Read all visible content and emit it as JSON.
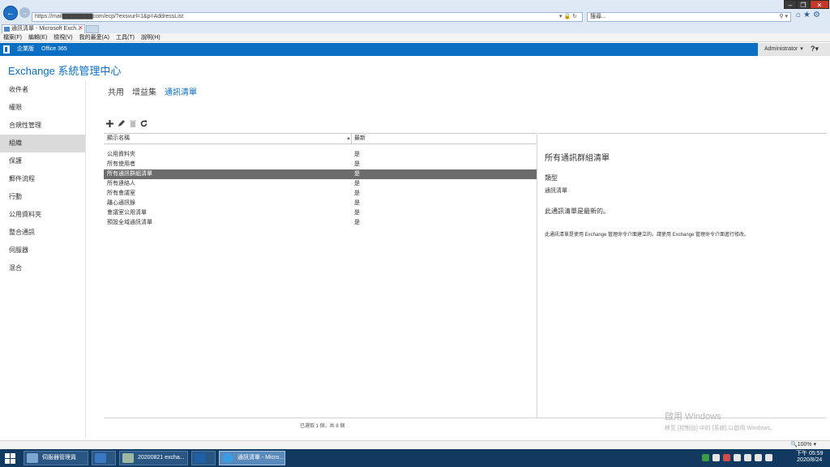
{
  "browser": {
    "address": "https://mail▇▇▇▇▇▇▇com/ecp/?exsvurl=1&p=AddressList",
    "search_placeholder": "搜尋...",
    "tab_title": "通訊清單 - Microsoft Exch...",
    "menu": [
      "檔案(F)",
      "編輯(E)",
      "檢視(V)",
      "我的最愛(A)",
      "工具(T)",
      "說明(H)"
    ],
    "zoom": "100%"
  },
  "o365": {
    "enterprise": "企業版",
    "office365": "Office 365",
    "user": "Administrator",
    "help": "?"
  },
  "eac": {
    "title": "Exchange 系統管理中心",
    "nav": [
      "收件者",
      "權限",
      "合規性管理",
      "組織",
      "保護",
      "郵件流程",
      "行動",
      "公用資料夾",
      "整合通訊",
      "伺服器",
      "混合"
    ],
    "active_nav": "組織",
    "subtabs": [
      "共用",
      "增益集",
      "通訊清單"
    ],
    "active_subtab": "通訊清單"
  },
  "list": {
    "col_name": "顯示名稱",
    "col_latest": "最新",
    "rows": [
      {
        "name": "公用資料夾",
        "latest": "是"
      },
      {
        "name": "所有使用者",
        "latest": "是"
      },
      {
        "name": "所有通訊群組清單",
        "latest": "是"
      },
      {
        "name": "所有連絡人",
        "latest": "是"
      },
      {
        "name": "所有會議室",
        "latest": "是"
      },
      {
        "name": "離心通訊錄",
        "latest": "是"
      },
      {
        "name": "會議室公用清單",
        "latest": "是"
      },
      {
        "name": "預設全域通訊清單",
        "latest": "是"
      }
    ],
    "selected_index": 2,
    "status": "已選取 1 個，共 8 個"
  },
  "details": {
    "title": "所有通訊群組清單",
    "type_label": "類型",
    "type_value": "通訊清單",
    "latest_text": "此通訊清單是最新的。",
    "note": "此通訊清單是使用 Exchange 管理命令介面建立的。請使用 Exchange 管理命令介面進行修改。"
  },
  "watermark": {
    "title": "啟用 Windows",
    "subtitle": "移至 [控制台] 中的 [系統] 以啟用 Windows。"
  },
  "taskbar": {
    "tasks": [
      "伺服器管理員",
      "",
      "20200821 excha...",
      "",
      "通訊清單 - Micro..."
    ],
    "time": "下午 05:59",
    "date": "2020/8/24"
  },
  "colors": {
    "brand_blue": "#0a6fc2",
    "selected_row": "#6c6c6c",
    "taskbar": "#12395f"
  }
}
